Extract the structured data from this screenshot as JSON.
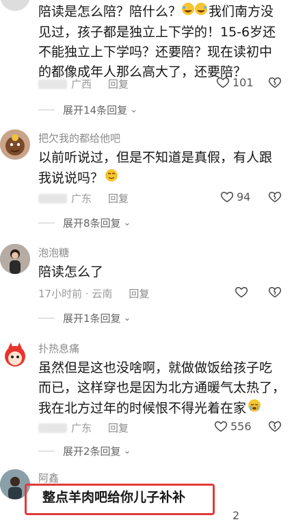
{
  "comments": [
    {
      "username": "",
      "text_lines": [
        "陪读是怎么陪？陪什么？",
        "我们南方没",
        "见过，孩子都是独立上下学的！15-6岁还",
        "不能独立上下学吗？还要陪？现在读初中",
        "的都像成年人那么高大了，还要陪？"
      ],
      "location": "广西",
      "reply_label": "回复",
      "likes": "101",
      "expand_label": "展开14条回复"
    },
    {
      "username": "把欠我的都给他吧",
      "text_lines": [
        "以前听说过，但是不知道是真假，有人跟",
        "我说说吗？"
      ],
      "location": "广东",
      "reply_label": "回复",
      "likes": "94",
      "expand_label": "展开8条回复"
    },
    {
      "username": "泡泡糖",
      "text_lines": [
        "陪读怎么了"
      ],
      "time_location": "17小时前 · 云南",
      "reply_label": "回复",
      "likes": "",
      "expand_label": "展开1条回复"
    },
    {
      "username": "扑热息痛",
      "text_lines": [
        "虽然但是这也没啥啊，就做做饭给孩子吃",
        "而已，这样穿也是因为北方通暖气太热了，",
        "我在北方过年的时候恨不得光着在家"
      ],
      "location": "广东",
      "reply_label": "回复",
      "likes": "556",
      "expand_label": "展开2条回复"
    },
    {
      "username": "阿鑫",
      "text_lines": [
        "整点羊肉吧给你儿子补补"
      ],
      "likes": "2"
    }
  ],
  "icons": {
    "like": "heart-outline-icon",
    "dislike": "broken-heart-icon",
    "chevron": "chevron-down-icon"
  },
  "colors": {
    "highlight": "#e03a3a"
  }
}
